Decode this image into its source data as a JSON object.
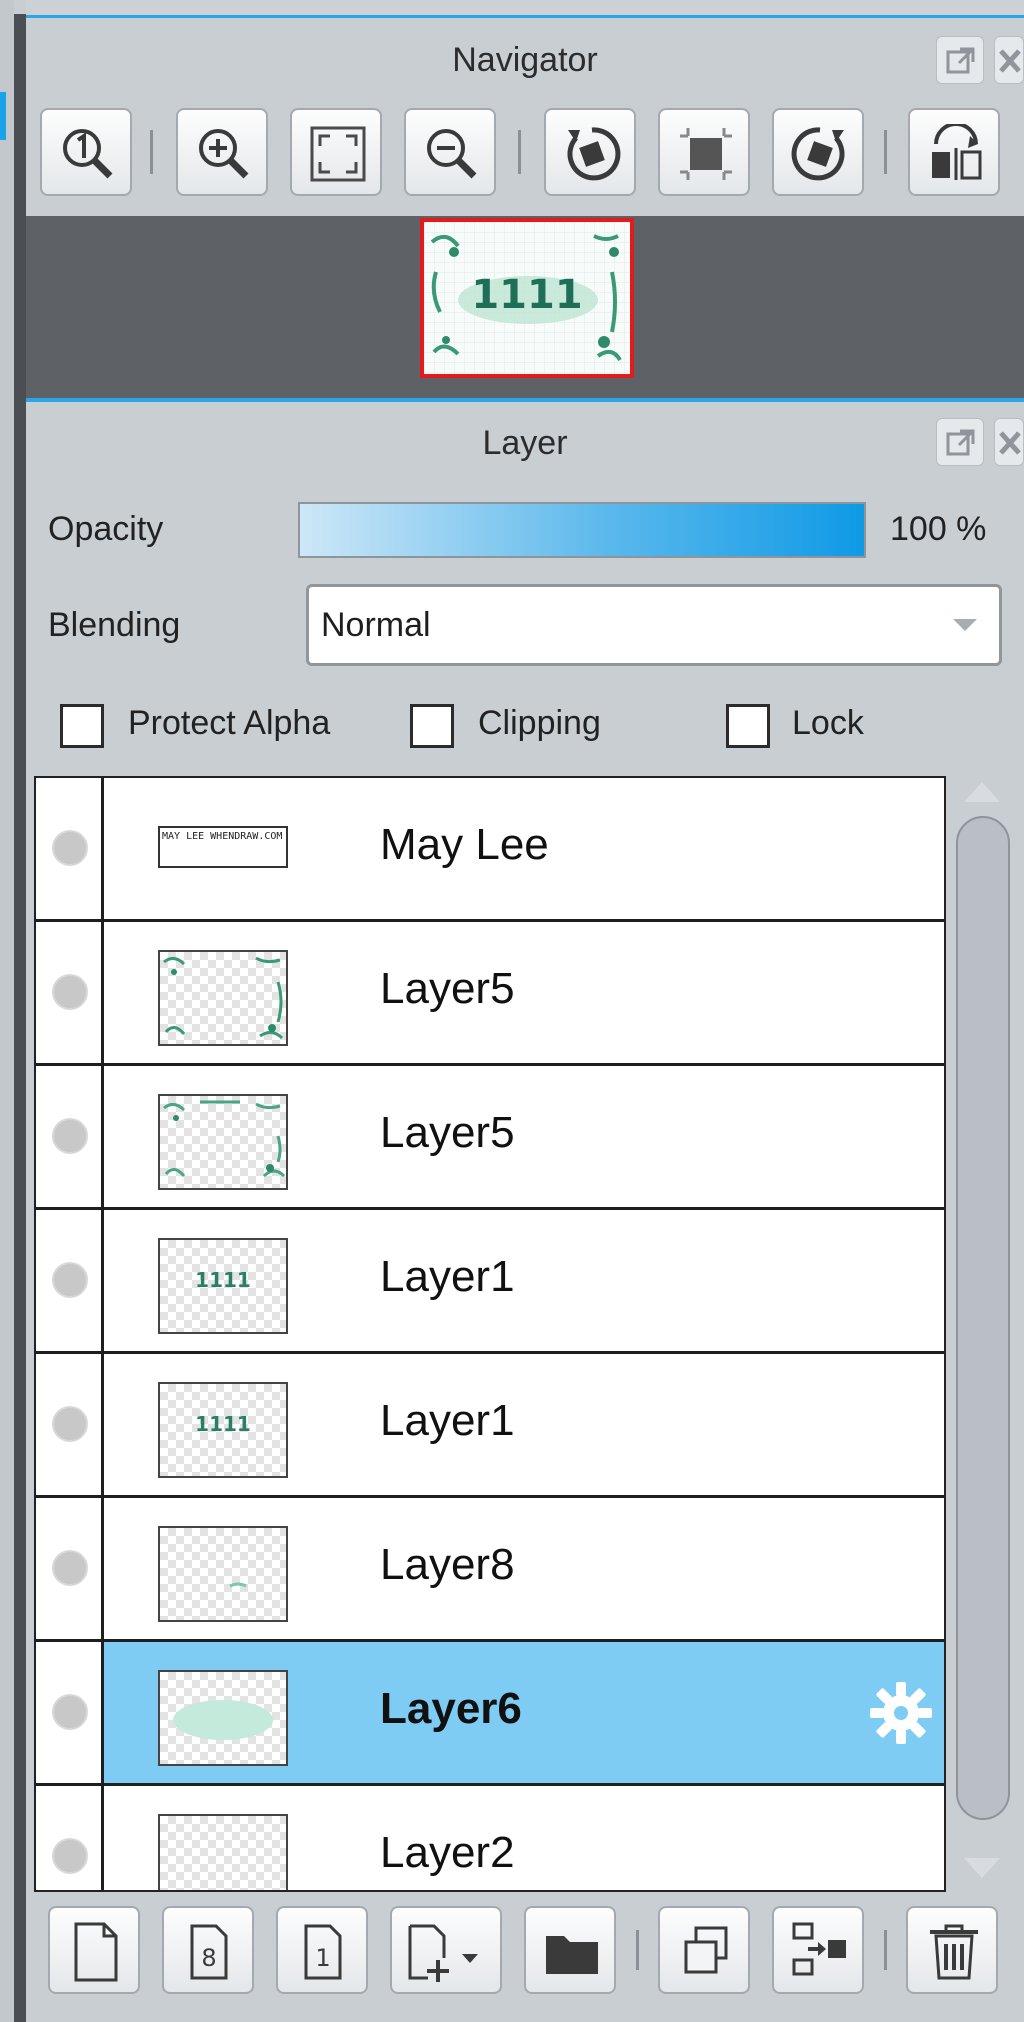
{
  "navigator": {
    "title": "Navigator",
    "toolbar": [
      "zoom-actual-size-icon",
      "zoom-in-icon",
      "fit-to-screen-icon",
      "zoom-out-icon",
      "rotate-left-icon",
      "reset-rotation-icon",
      "rotate-right-icon",
      "flip-horizontal-icon"
    ],
    "thumbnail_text": "1111"
  },
  "layer_panel": {
    "title": "Layer",
    "opacity_label": "Opacity",
    "opacity_value": "100 %",
    "opacity_fraction": 1.0,
    "blending_label": "Blending",
    "blending_value": "Normal",
    "protect_alpha_label": "Protect Alpha",
    "clipping_label": "Clipping",
    "lock_label": "Lock",
    "layers": [
      {
        "name": "May Lee",
        "thumb_text": "MAY LEE WHENDRAW.COM",
        "selected": false
      },
      {
        "name": "Layer5",
        "selected": false
      },
      {
        "name": "Layer5",
        "selected": false
      },
      {
        "name": "Layer1",
        "thumb_text": "1111",
        "selected": false
      },
      {
        "name": "Layer1",
        "thumb_text": "1111",
        "selected": false
      },
      {
        "name": "Layer8",
        "selected": false
      },
      {
        "name": "Layer6",
        "selected": true
      },
      {
        "name": "Layer2",
        "selected": false
      }
    ]
  },
  "bottom_toolbar": [
    "new-layer-icon",
    "new-8bit-layer-icon",
    "new-1bit-layer-icon",
    "add-layer-menu-icon",
    "new-folder-icon",
    "duplicate-layer-icon",
    "merge-down-icon",
    "delete-layer-icon"
  ],
  "colors": {
    "accent": "#2ba6e4",
    "selected_row": "#7ecbf4",
    "nav_border": "#e21c1c"
  }
}
